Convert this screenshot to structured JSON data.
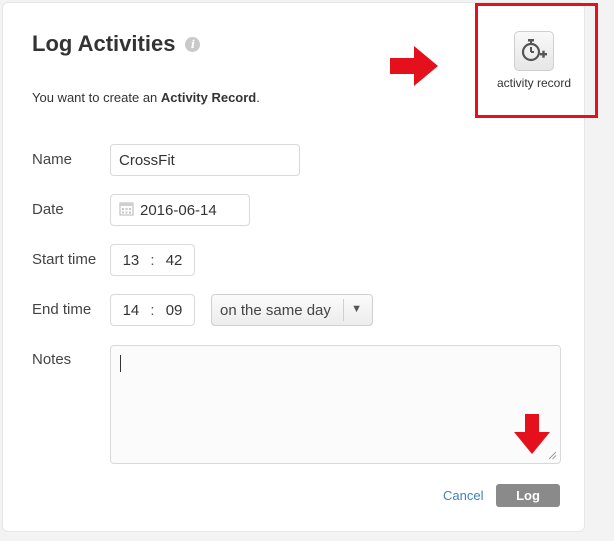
{
  "dialog": {
    "title": "Log Activities",
    "info_icon_glyph": "i",
    "subtitle_prefix": "You want to create an ",
    "subtitle_bold": "Activity Record",
    "subtitle_suffix": "."
  },
  "record_button": {
    "label": "activity record",
    "icon": "stopwatch-plus-icon"
  },
  "form": {
    "name_label": "Name",
    "name_value": "CrossFit",
    "date_label": "Date",
    "date_value": "2016-06-14",
    "start_label": "Start time",
    "start_hour": "13",
    "start_minute": "42",
    "end_label": "End time",
    "end_hour": "14",
    "end_minute": "09",
    "time_separator": ":",
    "day_option": "on the same day",
    "notes_label": "Notes",
    "notes_value": ""
  },
  "actions": {
    "cancel_label": "Cancel",
    "log_label": "Log"
  },
  "colors": {
    "highlight": "#e4101c",
    "link": "#3d80c5",
    "log_button": "#8a8a8a"
  }
}
